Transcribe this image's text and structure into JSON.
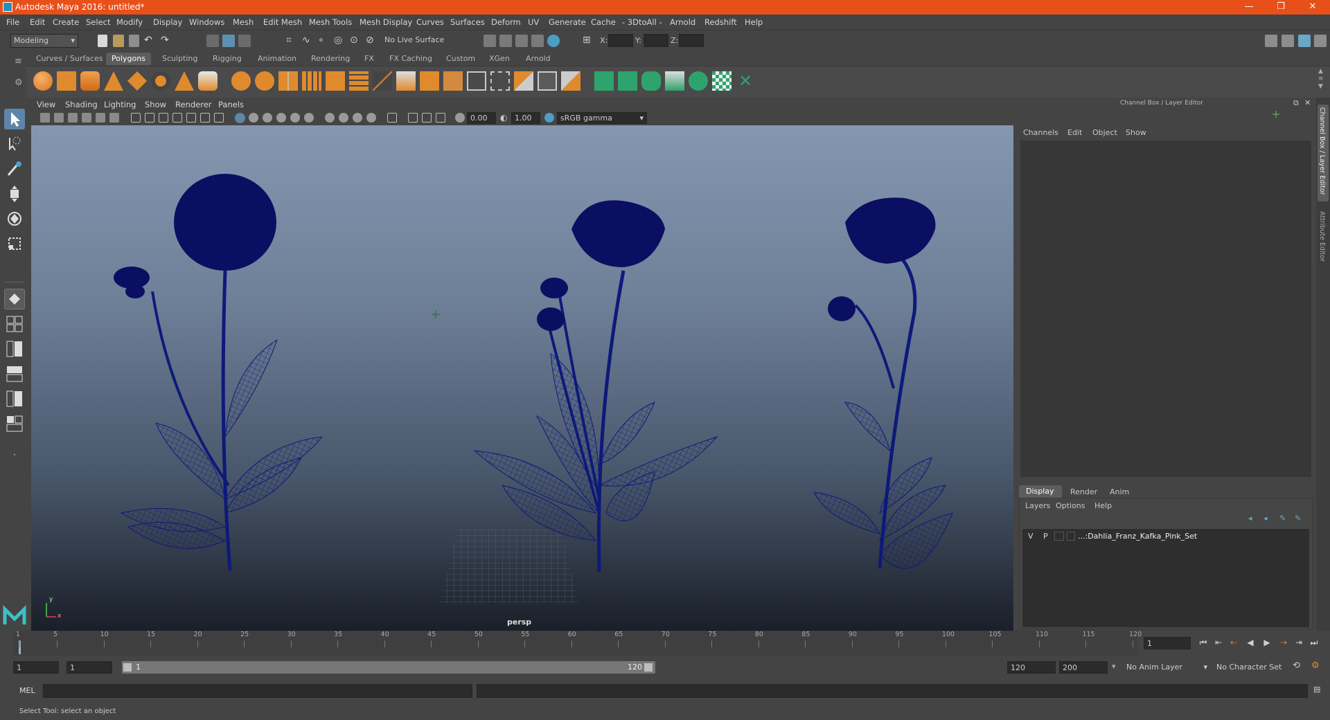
{
  "window": {
    "title": "Autodesk Maya 2016: untitled*",
    "minimize": "—",
    "restore": "❐",
    "close": "✕"
  },
  "menubar": [
    "File",
    "Edit",
    "Create",
    "Select",
    "Modify",
    "Display",
    "Windows",
    "Mesh",
    "Edit Mesh",
    "Mesh Tools",
    "Mesh Display",
    "Curves",
    "Surfaces",
    "Deform",
    "UV",
    "Generate",
    "Cache",
    "- 3DtoAll -",
    "Arnold",
    "Redshift",
    "Help"
  ],
  "statusline": {
    "menuset": "Modeling",
    "live_surface": "No Live Surface",
    "x_label": "X:",
    "y_label": "Y:",
    "z_label": "Z:"
  },
  "shelf_tabs": [
    "Curves / Surfaces",
    "Polygons",
    "Sculpting",
    "Rigging",
    "Animation",
    "Rendering",
    "FX",
    "FX Caching",
    "Custom",
    "XGen",
    "Arnold"
  ],
  "shelf_active": "Polygons",
  "viewport": {
    "menus": [
      "View",
      "Shading",
      "Lighting",
      "Show",
      "Renderer",
      "Panels"
    ],
    "exposure": "0.00",
    "gamma": "1.00",
    "colorspace": "sRGB gamma",
    "camera_label": "persp",
    "axis_y": "y",
    "axis_x": "x"
  },
  "channel_box": {
    "header": "Channel Box / Layer Editor",
    "menus": [
      "Channels",
      "Edit",
      "Object",
      "Show"
    ]
  },
  "layer_editor": {
    "tabs": [
      "Display",
      "Render",
      "Anim"
    ],
    "active_tab": "Display",
    "menus": [
      "Layers",
      "Options",
      "Help"
    ],
    "layers": [
      {
        "v": "V",
        "p": "P",
        "name": "...:Dahlia_Franz_Kafka_Pink_Set"
      }
    ]
  },
  "side_tabs": {
    "channel": "Channel Box / Layer Editor",
    "attribute": "Attribute Editor"
  },
  "timeline": {
    "ticks": [
      "1",
      "5",
      "10",
      "15",
      "20",
      "25",
      "30",
      "35",
      "40",
      "45",
      "50",
      "55",
      "60",
      "65",
      "70",
      "75",
      "80",
      "85",
      "90",
      "95",
      "100",
      "105",
      "110",
      "115",
      "120"
    ],
    "current_frame": "1"
  },
  "range": {
    "start": "1",
    "playback_start": "1",
    "slider_start": "1",
    "slider_end": "120",
    "playback_end": "120",
    "end": "200",
    "anim_layer": "No Anim Layer",
    "character_set": "No Character Set"
  },
  "cmdline": {
    "label": "MEL"
  },
  "helpline": {
    "text": "Select Tool: select an object"
  },
  "colors": {
    "title_bar": "#e8501a",
    "wireframe": "#0d1a7a",
    "active_tab": "#5d5d5d",
    "accent": "#4b9ec4"
  }
}
